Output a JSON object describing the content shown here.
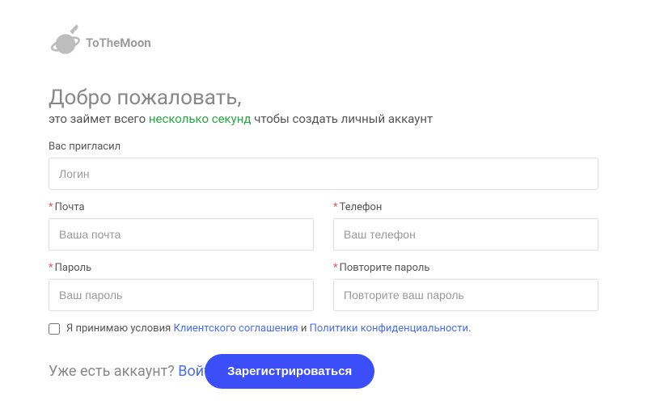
{
  "logo": {
    "text_prefix": "ToThe",
    "text_strong": "Moon"
  },
  "welcome": {
    "title": "Добро пожаловать,",
    "sub_prefix": "это займет всего ",
    "sub_highlight": "несколько секунд",
    "sub_suffix": " чтобы создать личный аккаунт"
  },
  "fields": {
    "inviter": {
      "label": "Вас пригласил",
      "placeholder": "Логин"
    },
    "email": {
      "label": "Почта",
      "placeholder": "Ваша почта"
    },
    "phone": {
      "label": "Телефон",
      "placeholder": "Ваш телефон"
    },
    "password": {
      "label": "Пароль",
      "placeholder": "Ваш пароль"
    },
    "password2": {
      "label": "Повторите пароль",
      "placeholder": "Повторите ваш пароль"
    },
    "required_mark": "*"
  },
  "terms": {
    "prefix": "Я принимаю условия ",
    "link1": "Клиентского соглашения",
    "and": " и ",
    "link2": "Политики конфиденциальности",
    "dot": "."
  },
  "footer": {
    "prompt": "Уже есть аккаунт? ",
    "login_link": "Войти",
    "submit": "Зарегистрироваться"
  }
}
